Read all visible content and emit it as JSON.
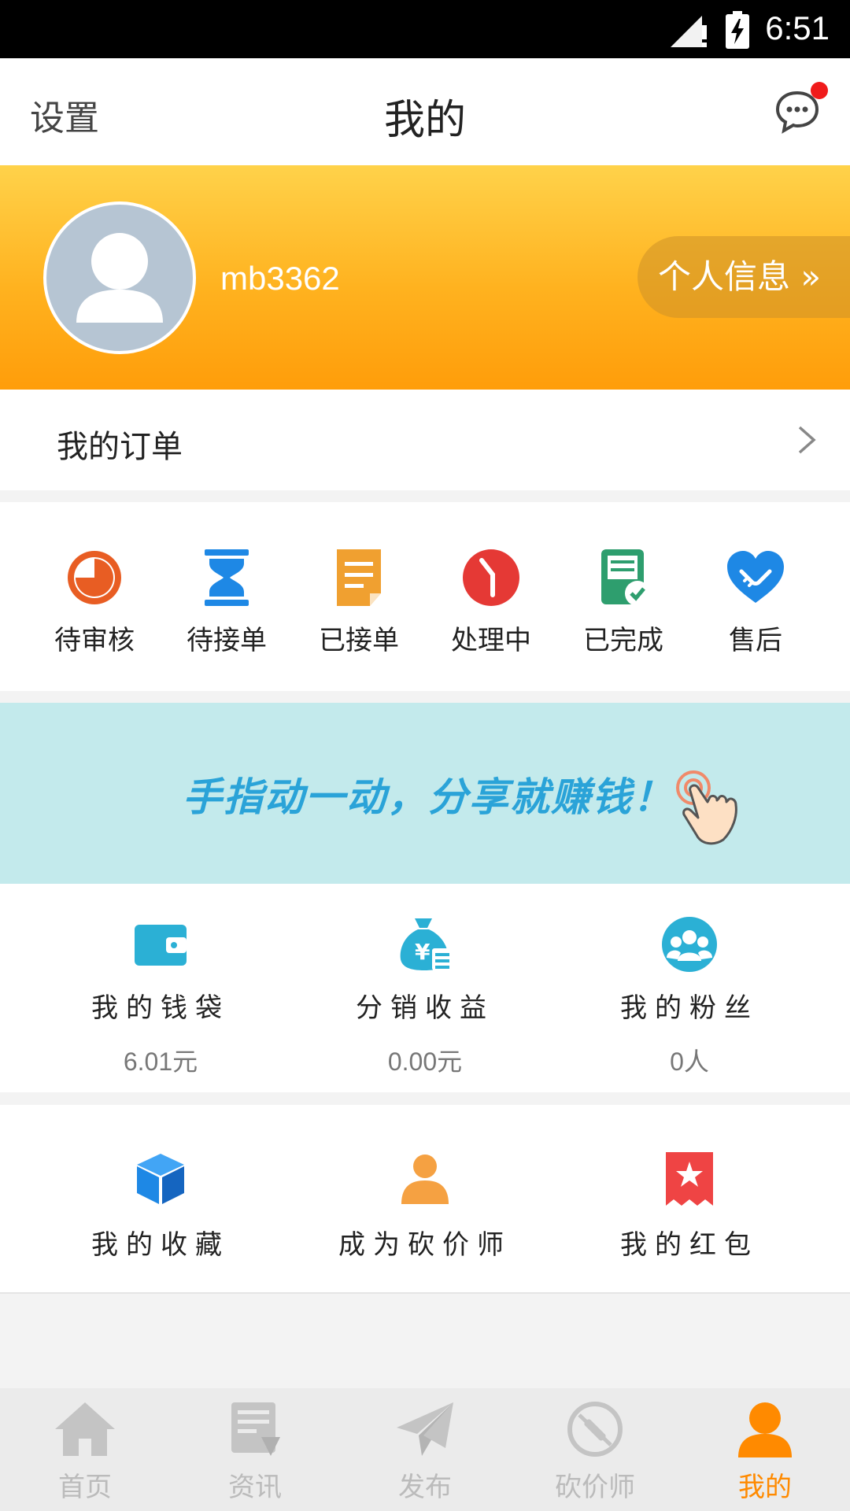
{
  "status_bar": {
    "time": "6:51"
  },
  "header": {
    "settings_label": "设置",
    "title": "我的",
    "message_icon": "chat-bubble-icon"
  },
  "profile": {
    "username": "mb3362",
    "info_button": "个人信息 »"
  },
  "orders": {
    "label": "我的订单"
  },
  "order_status": [
    {
      "label": "待审核",
      "icon": "pie-clock-icon",
      "color": "#e85d23"
    },
    {
      "label": "待接单",
      "icon": "hourglass-icon",
      "color": "#1e88e5"
    },
    {
      "label": "已接单",
      "icon": "document-icon",
      "color": "#f0a030"
    },
    {
      "label": "处理中",
      "icon": "clock-icon",
      "color": "#e53935"
    },
    {
      "label": "已完成",
      "icon": "checked-document-icon",
      "color": "#2e9e6e"
    },
    {
      "label": "售后",
      "icon": "handshake-heart-icon",
      "color": "#1e88e5"
    }
  ],
  "promo": {
    "text": "手指动一动，分享就赚钱！"
  },
  "earnings": [
    {
      "label": "我的钱袋",
      "value": "6.01元",
      "icon": "wallet-icon"
    },
    {
      "label": "分销收益",
      "value": "0.00元",
      "icon": "money-bag-icon"
    },
    {
      "label": "我的粉丝",
      "value": "0人",
      "icon": "fans-icon"
    }
  ],
  "tools": [
    {
      "label": "我的收藏",
      "icon": "cube-icon"
    },
    {
      "label": "成为砍价师",
      "icon": "person-icon"
    },
    {
      "label": "我的红包",
      "icon": "red-packet-icon"
    }
  ],
  "tabs": [
    {
      "label": "首页",
      "icon": "home-icon",
      "active": false
    },
    {
      "label": "资讯",
      "icon": "news-icon",
      "active": false
    },
    {
      "label": "发布",
      "icon": "paper-plane-icon",
      "active": false
    },
    {
      "label": "砍价师",
      "icon": "bargain-icon",
      "active": false
    },
    {
      "label": "我的",
      "icon": "profile-icon",
      "active": true
    }
  ],
  "colors": {
    "accent": "#ff9d0a",
    "tab_active": "#ff8a00",
    "tab_inactive": "#bbbbbb",
    "promo_bg": "#c3eaec"
  }
}
